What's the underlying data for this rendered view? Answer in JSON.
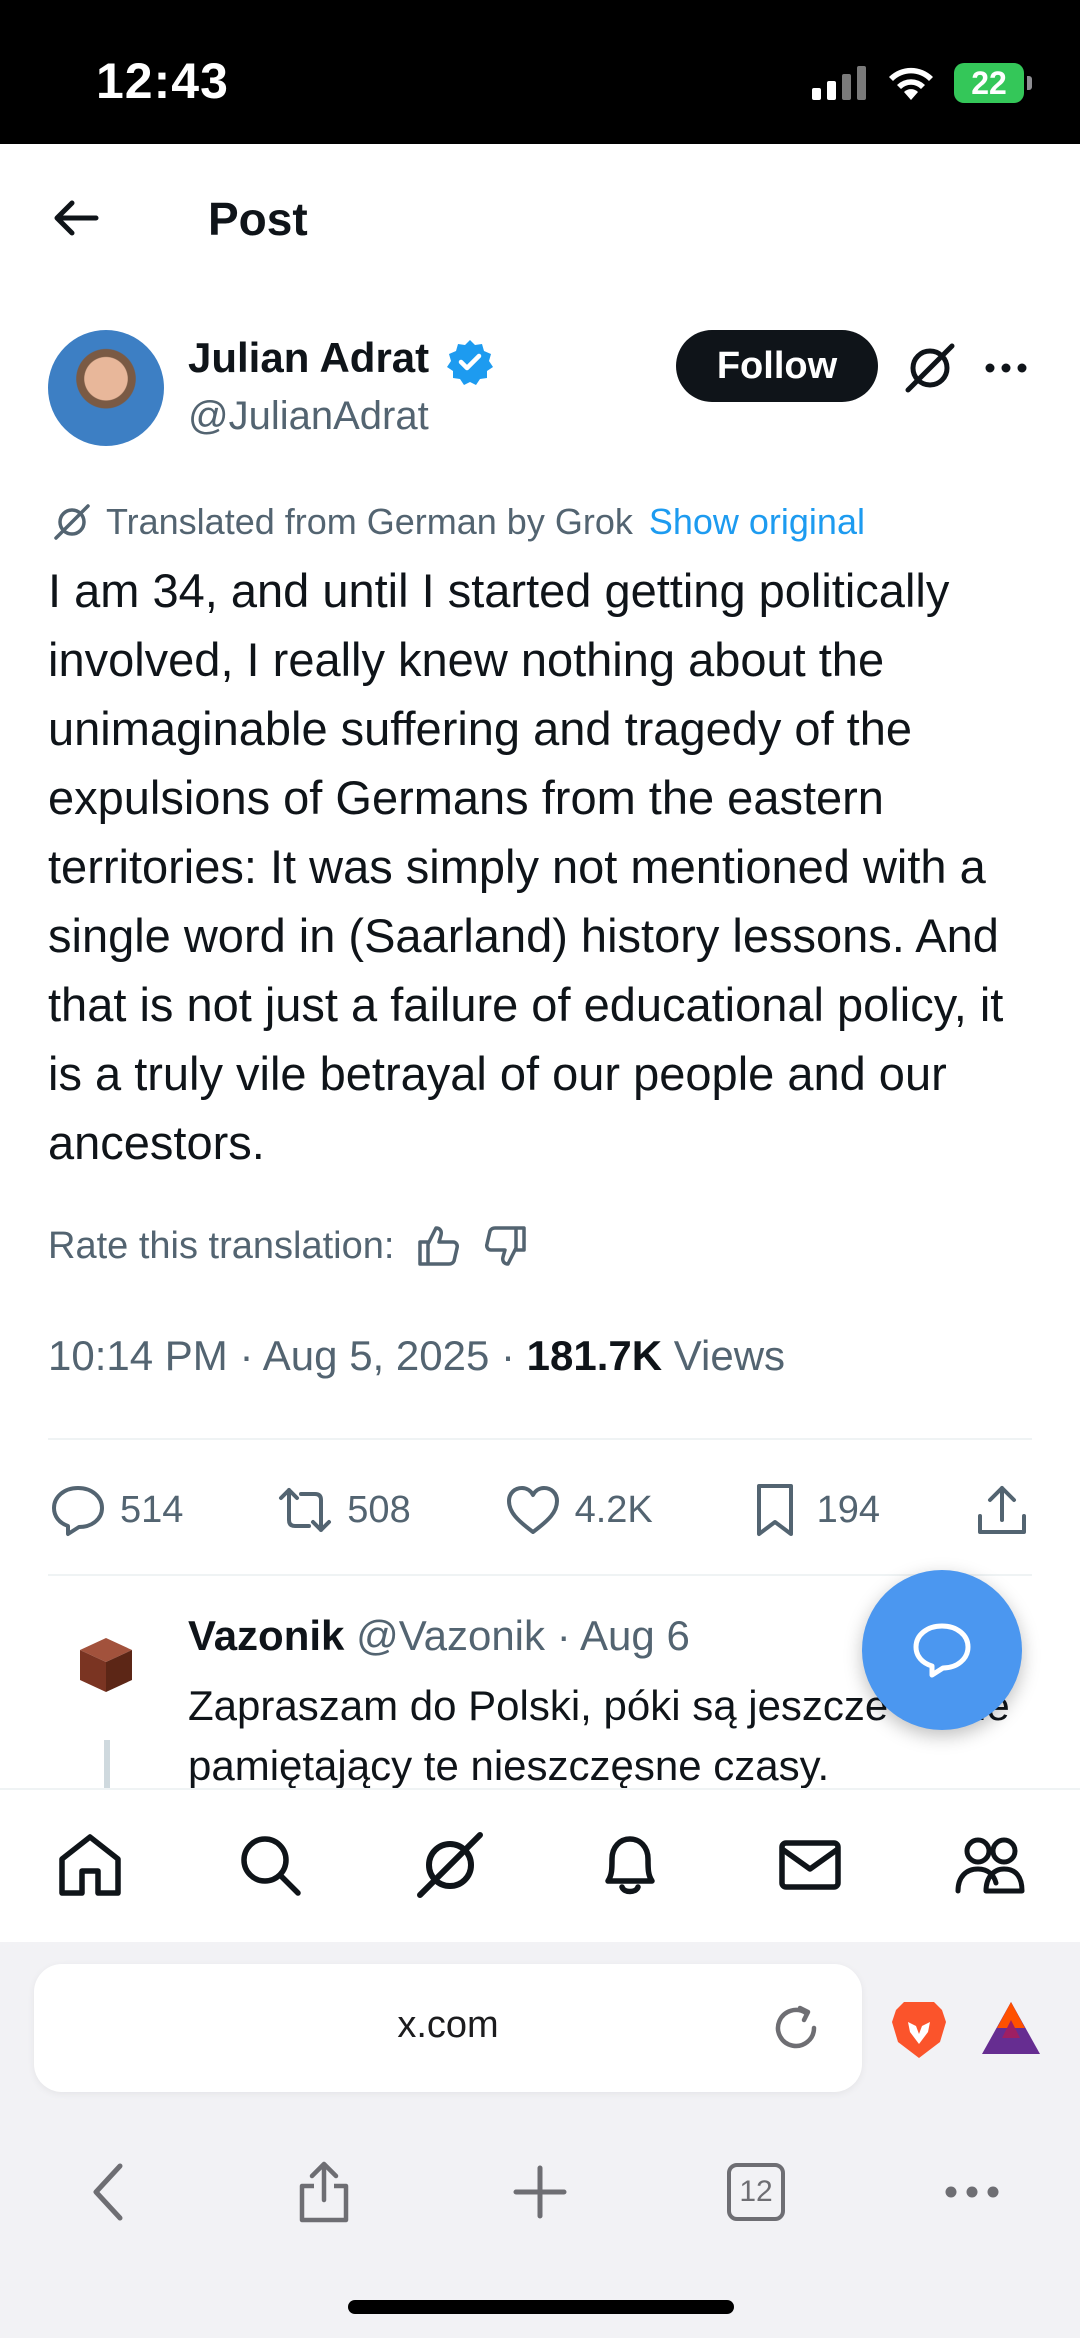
{
  "status_bar": {
    "time": "12:43",
    "battery": "22"
  },
  "header": {
    "title": "Post"
  },
  "author": {
    "name": "Julian Adrat",
    "handle": "@JulianAdrat",
    "follow_label": "Follow"
  },
  "translation": {
    "note": "Translated from German by Grok",
    "show_original": "Show original"
  },
  "post": {
    "text": "I am 34, and until I started getting politically involved, I really knew nothing about the unimaginable suffering and tragedy of the expulsions of Germans from the eastern territories: It was simply not mentioned with a single word in (Saarland) history lessons. And that is not just a failure of educational policy, it is a truly vile betrayal of our people and our ancestors.",
    "rate_label": "Rate this translation:",
    "time": "10:14 PM",
    "date": "Aug 5, 2025",
    "views_count": "181.7K",
    "views_label": "Views"
  },
  "actions": {
    "replies": "514",
    "reposts": "508",
    "likes": "4.2K",
    "bookmarks": "194"
  },
  "reply": {
    "name": "Vazonik",
    "handle": "@Vazonik",
    "date": "Aug 6",
    "text": "Zapraszam do Polski, póki są jeszcze ludzie pamiętający te nieszczęsne czasy."
  },
  "browser": {
    "url": "x.com",
    "tab_count": "12"
  },
  "colors": {
    "accent": "#1d9bf0",
    "fab": "#4b97f0",
    "battery": "#34c759"
  },
  "icons": [
    "back-arrow-icon",
    "verified-badge-icon",
    "grok-icon",
    "more-icon",
    "reply-icon",
    "repost-icon",
    "like-icon",
    "bookmark-icon",
    "share-icon",
    "home-icon",
    "search-icon",
    "notifications-icon",
    "messages-icon",
    "communities-icon",
    "reload-icon",
    "brave-icon",
    "bat-icon"
  ]
}
